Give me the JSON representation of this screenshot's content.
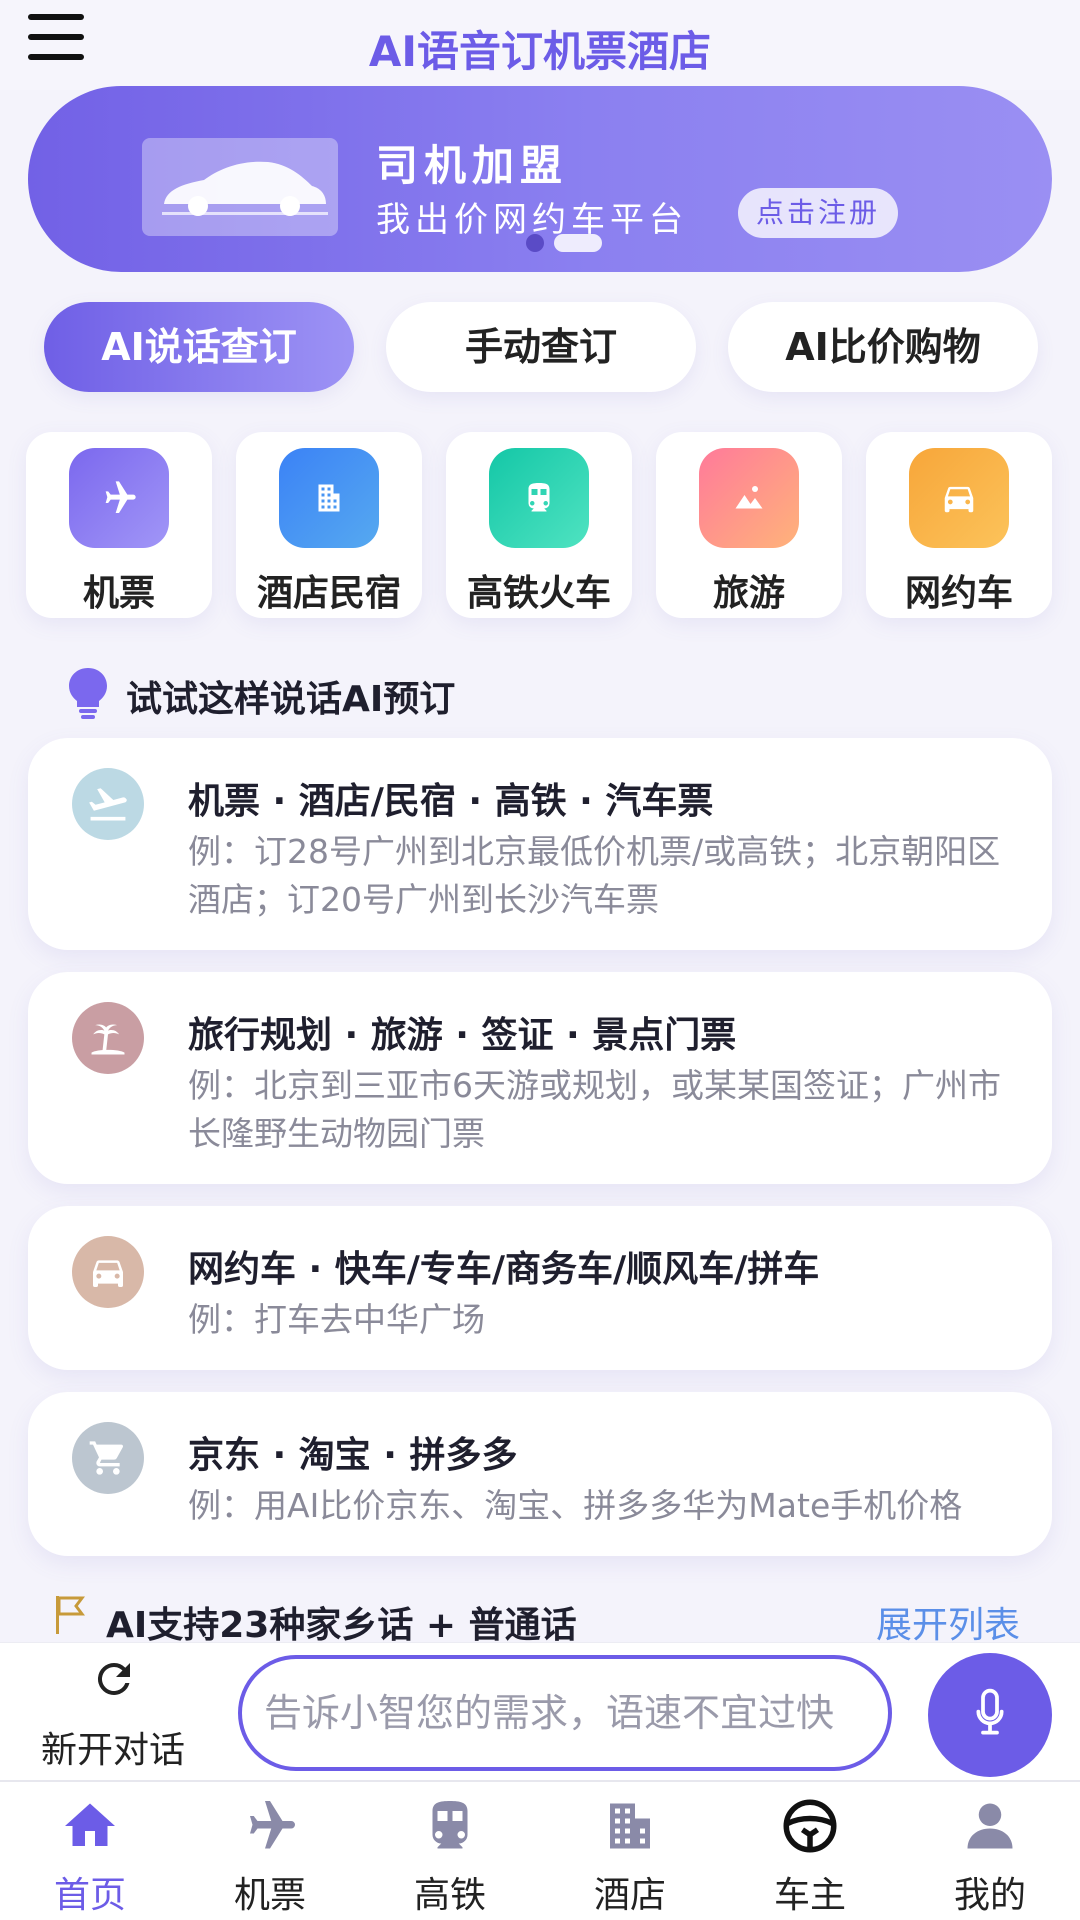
{
  "header": {
    "title": "AI语音订机票酒店",
    "menu_icon": "menu-icon"
  },
  "banner": {
    "title": "司机加盟",
    "subtitle": "我出价网约车平台",
    "cta": "点击注册",
    "slides": 2,
    "active_slide": 0
  },
  "mode_tabs": [
    {
      "label": "AI说话查订",
      "active": true
    },
    {
      "label": "手动查订",
      "active": false
    },
    {
      "label": "AI比价购物",
      "active": false
    }
  ],
  "categories": [
    {
      "label": "机票",
      "icon": "plane-icon",
      "color_from": "#7b68ee",
      "color_to": "#a196f7"
    },
    {
      "label": "酒店民宿",
      "icon": "building-icon",
      "color_from": "#3b82f6",
      "color_to": "#56a9f0"
    },
    {
      "label": "高铁火车",
      "icon": "train-icon",
      "color_from": "#14c7a7",
      "color_to": "#4fe3c1"
    },
    {
      "label": "旅游",
      "icon": "mountain-icon",
      "color_from": "#ff7a9a",
      "color_to": "#ffb37a"
    },
    {
      "label": "网约车",
      "icon": "car-icon",
      "color_from": "#f7a63a",
      "color_to": "#fcc35a"
    }
  ],
  "tips": {
    "title": "试试这样说话AI预订",
    "items": [
      {
        "title": "机票 · 酒店/民宿 · 高铁 · 汽车票",
        "desc": "例：订28号广州到北京最低价机票/或高铁；北京朝阳区酒店；订20号广州到长沙汽车票",
        "icon": "plane-icon",
        "icon_bg": "#bcd9e4"
      },
      {
        "title": "旅行规划 · 旅游 · 签证 · 景点门票",
        "desc": "例：北京到三亚市6天游或规划，或某某国签证；广州市长隆野生动物园门票",
        "icon": "palm-tree-icon",
        "icon_bg": "#c99ea3"
      },
      {
        "title": "网约车 ·  快车/专车/商务车/顺风车/拼车",
        "desc": "例：打车去中华广场",
        "icon": "car-icon",
        "icon_bg": "#d8b8a8"
      },
      {
        "title": "京东 · 淘宝 · 拼多多",
        "desc": "例：用AI比价京东、淘宝、拼多多华为Mate手机价格",
        "icon": "cart-icon",
        "icon_bg": "#bcc6d0"
      }
    ]
  },
  "dialect": {
    "text": "AI支持23种家乡话 + 普通话",
    "link": "展开列表"
  },
  "input_bar": {
    "new_chat": "新开对话",
    "placeholder": "告诉小智您的需求，语速不宜过快"
  },
  "tabbar": [
    {
      "label": "首页",
      "icon": "home-icon",
      "active": true
    },
    {
      "label": "机票",
      "icon": "plane-icon",
      "active": false
    },
    {
      "label": "高铁",
      "icon": "train-icon",
      "active": false
    },
    {
      "label": "酒店",
      "icon": "building-icon",
      "active": false
    },
    {
      "label": "车主",
      "icon": "steering-wheel-icon",
      "active": false
    },
    {
      "label": "我的",
      "icon": "user-icon",
      "active": false
    }
  ],
  "colors": {
    "accent": "#6c5ce7",
    "link": "#5b8fe8",
    "background": "#f4f3fb"
  }
}
